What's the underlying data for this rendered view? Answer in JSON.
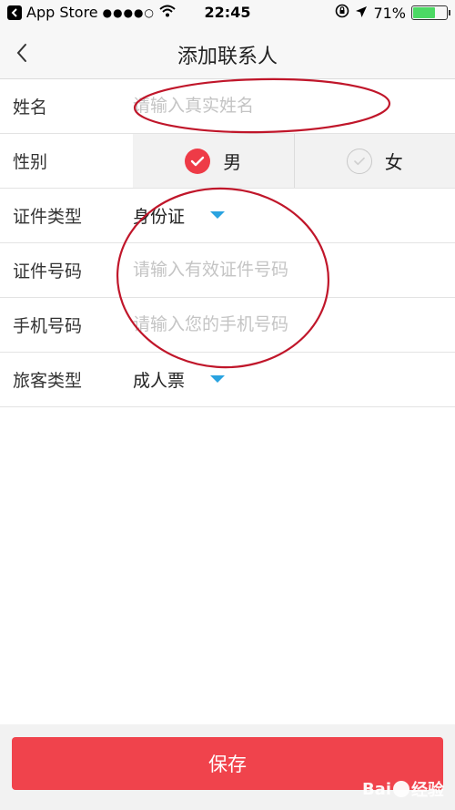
{
  "status_bar": {
    "carrier": "App Store",
    "signal_dots": "●●●●○",
    "time": "22:45",
    "battery_percent": "71%",
    "battery_level": 0.71,
    "battery_color": "#4cd964"
  },
  "nav": {
    "title": "添加联系人",
    "back_icon": "chevron-left-icon"
  },
  "form": {
    "name": {
      "label": "姓名",
      "placeholder": "请输入真实姓名",
      "value": ""
    },
    "gender": {
      "label": "性别",
      "options": [
        {
          "label": "男",
          "selected": true
        },
        {
          "label": "女",
          "selected": false
        }
      ]
    },
    "id_type": {
      "label": "证件类型",
      "value": "身份证"
    },
    "id_number": {
      "label": "证件号码",
      "placeholder": "请输入有效证件号码",
      "value": ""
    },
    "phone": {
      "label": "手机号码",
      "placeholder": "请输入您的手机号码",
      "value": ""
    },
    "traveler_type": {
      "label": "旅客类型",
      "value": "成人票"
    }
  },
  "actions": {
    "save_label": "保存"
  },
  "watermark": {
    "text_left": "Bai",
    "text_right": "经验"
  },
  "colors": {
    "accent_red": "#f0434c",
    "dropdown_blue": "#2aa3e0",
    "annotation_red": "#c0162a"
  }
}
